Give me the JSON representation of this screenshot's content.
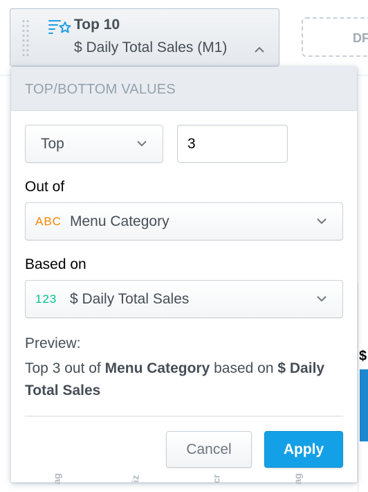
{
  "filter_button": {
    "title": "Top 10",
    "subtitle": "$ Daily Total Sales (M1)"
  },
  "background": {
    "ghost_tile_text": "DF",
    "chart_dollar": "$"
  },
  "popup": {
    "header": "TOP/BOTTOM VALUES",
    "direction_select": {
      "selected": "Top"
    },
    "count_input": {
      "value": "3"
    },
    "out_of": {
      "label": "Out of",
      "type_tag": "ABC",
      "selected": "Menu Category"
    },
    "based_on": {
      "label": "Based on",
      "type_tag": "123",
      "selected": "$ Daily Total Sales"
    },
    "preview": {
      "label": "Preview:",
      "prefix": "Top 3 out of ",
      "attribute": "Menu Category",
      "middle": " based on ",
      "metric": "$ Daily Total Sales"
    },
    "buttons": {
      "cancel": "Cancel",
      "apply": "Apply"
    }
  },
  "colors": {
    "accent": "#14a0e6",
    "attribute_tag": "#f18600",
    "metric_tag": "#00c18e"
  }
}
